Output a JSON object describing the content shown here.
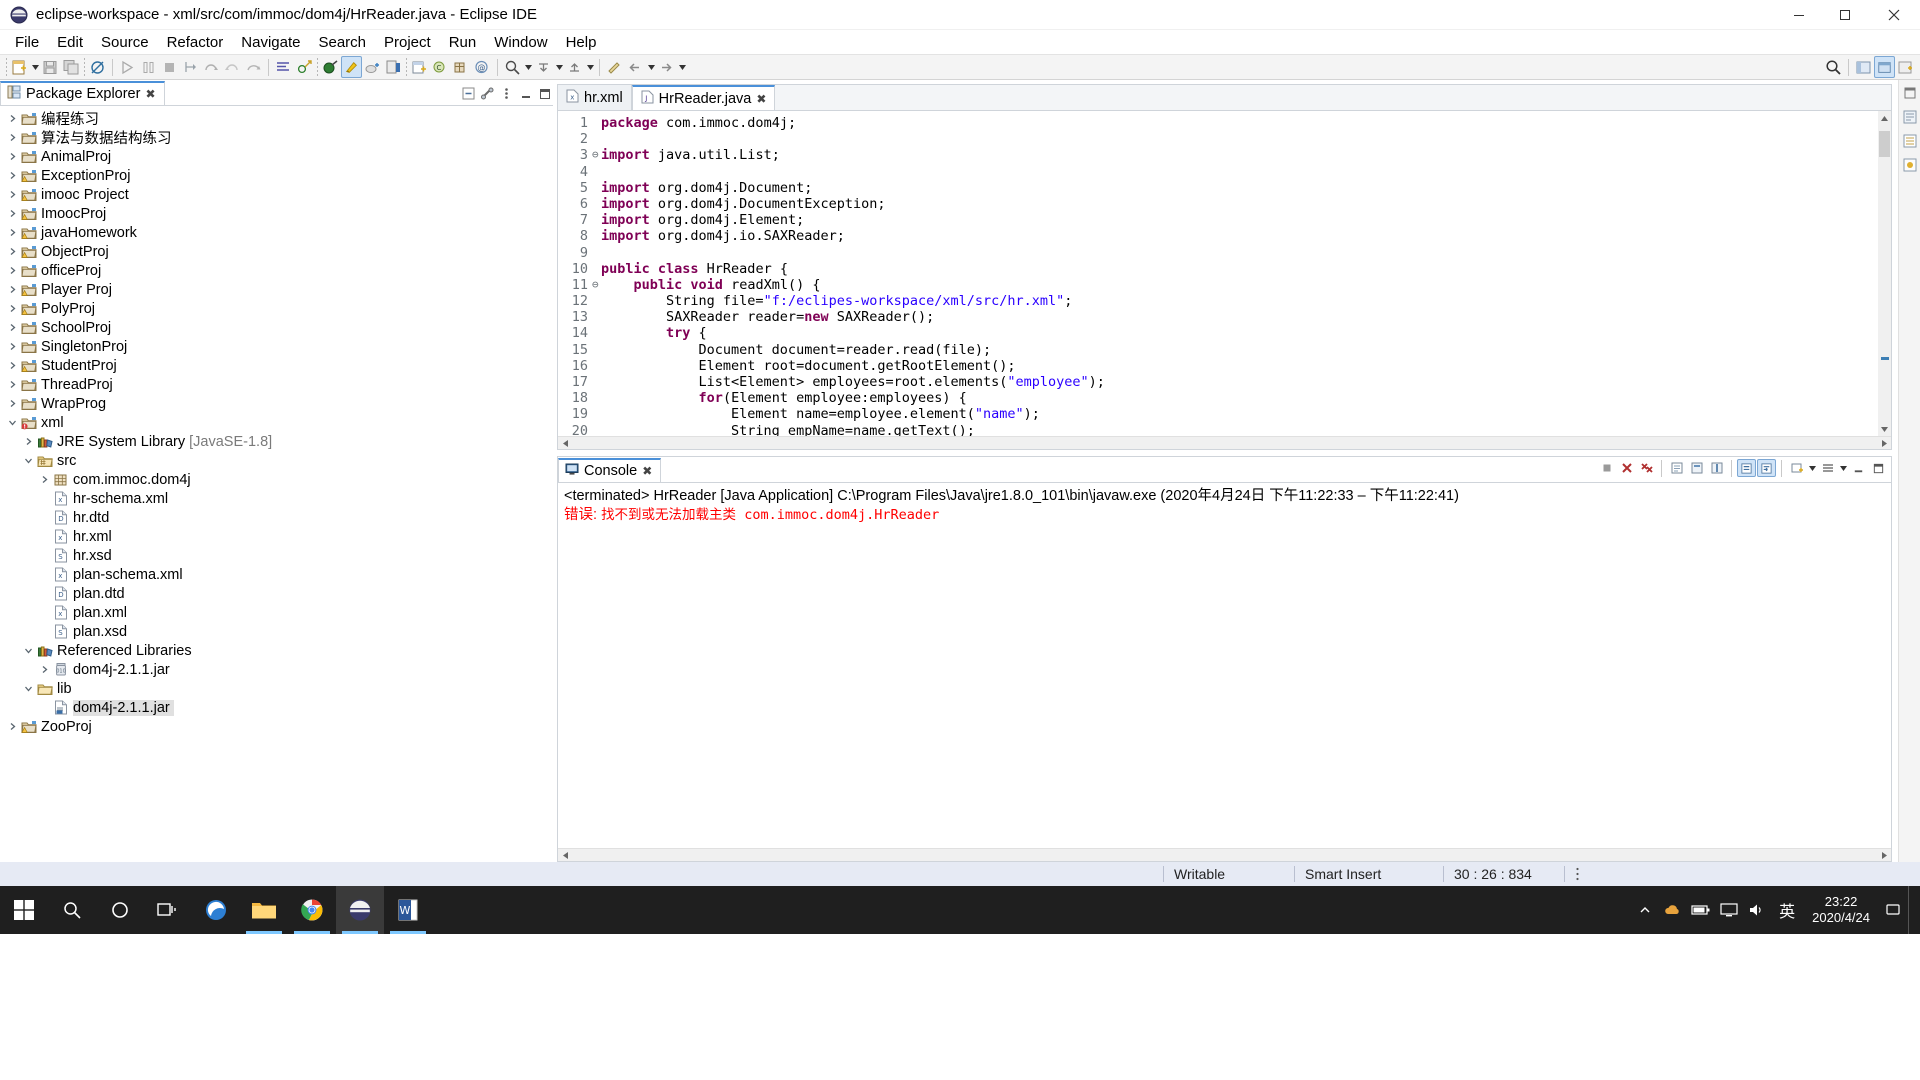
{
  "window": {
    "title": "eclipse-workspace - xml/src/com/immoc/dom4j/HrReader.java - Eclipse IDE",
    "app_icon": "eclipse-icon",
    "minimize_label": "—",
    "maximize_label": "❐",
    "close_label": "✕"
  },
  "menubar": {
    "items": [
      {
        "label": "File"
      },
      {
        "label": "Edit"
      },
      {
        "label": "Source"
      },
      {
        "label": "Refactor"
      },
      {
        "label": "Navigate"
      },
      {
        "label": "Search"
      },
      {
        "label": "Project"
      },
      {
        "label": "Run"
      },
      {
        "label": "Window"
      },
      {
        "label": "Help"
      }
    ]
  },
  "toolbar": {
    "groups": [
      [
        "new-wizard-icon",
        "dropdown-arrow",
        "save-icon",
        "save-all-icon"
      ],
      [
        "toggle-breadcrumb-icon"
      ],
      [
        "run-icon",
        "pause-icon",
        "stop-icon",
        "step-into-icon",
        "step-over-icon",
        "step-return-icon",
        "resume-icon"
      ],
      [
        "open-task-icon",
        "skip-breakpoints-icon"
      ],
      [
        "new-java-project-icon",
        "new-java-class-icon",
        "new-package-icon",
        "new-annotation-icon"
      ],
      [
        "open-type-icon",
        "quick-access-icon"
      ],
      [
        "toggle-mark-occurrences-icon",
        "show-whitespace-icon",
        "block-selection-icon"
      ],
      [
        "debug-icon",
        "run-as-icon",
        "coverage-icon",
        "external-tools-icon"
      ],
      [
        "search-icon",
        "next-annotation-icon",
        "previous-annotation-icon",
        "last-edit-icon",
        "back-icon",
        "forward-icon"
      ]
    ],
    "right": [
      "search-icon",
      "perspective-java-icon",
      "perspective-debug-icon",
      "open-perspective-icon"
    ]
  },
  "package_explorer": {
    "tab_label": "Package Explorer",
    "tab_icon": "package-explorer-icon",
    "close_icon": "close-icon",
    "view_buttons": [
      "collapse-all-icon",
      "link-with-editor-icon",
      "view-menu-icon",
      "minimize-icon",
      "maximize-icon"
    ],
    "tree": [
      {
        "label": "编程练习",
        "indent": 0,
        "state": "collapsed",
        "icon": "project-icon"
      },
      {
        "label": "算法与数据结构练习",
        "indent": 0,
        "state": "collapsed",
        "icon": "project-icon"
      },
      {
        "label": "AnimalProj",
        "indent": 0,
        "state": "collapsed",
        "icon": "project-icon"
      },
      {
        "label": "ExceptionProj",
        "indent": 0,
        "state": "collapsed",
        "icon": "project-warning-icon"
      },
      {
        "label": "imooc Project",
        "indent": 0,
        "state": "collapsed",
        "icon": "project-warning-icon"
      },
      {
        "label": "ImoocProj",
        "indent": 0,
        "state": "collapsed",
        "icon": "project-warning-icon"
      },
      {
        "label": "javaHomework",
        "indent": 0,
        "state": "collapsed",
        "icon": "project-warning-icon"
      },
      {
        "label": "ObjectProj",
        "indent": 0,
        "state": "collapsed",
        "icon": "project-warning-icon"
      },
      {
        "label": "officeProj",
        "indent": 0,
        "state": "collapsed",
        "icon": "project-icon"
      },
      {
        "label": "Player Proj",
        "indent": 0,
        "state": "collapsed",
        "icon": "project-warning-icon"
      },
      {
        "label": "PolyProj",
        "indent": 0,
        "state": "collapsed",
        "icon": "project-warning-icon"
      },
      {
        "label": "SchoolProj",
        "indent": 0,
        "state": "collapsed",
        "icon": "project-icon"
      },
      {
        "label": "SingletonProj",
        "indent": 0,
        "state": "collapsed",
        "icon": "project-icon"
      },
      {
        "label": "StudentProj",
        "indent": 0,
        "state": "collapsed",
        "icon": "project-warning-icon"
      },
      {
        "label": "ThreadProj",
        "indent": 0,
        "state": "collapsed",
        "icon": "project-icon"
      },
      {
        "label": "WrapProg",
        "indent": 0,
        "state": "collapsed",
        "icon": "project-icon"
      },
      {
        "label": "xml",
        "indent": 0,
        "state": "expanded",
        "icon": "project-error-icon"
      },
      {
        "label": "JRE System Library",
        "sublabel": " [JavaSE-1.8]",
        "indent": 1,
        "state": "collapsed",
        "icon": "library-icon"
      },
      {
        "label": "src",
        "indent": 1,
        "state": "expanded",
        "icon": "source-folder-icon"
      },
      {
        "label": "com.immoc.dom4j",
        "indent": 2,
        "state": "collapsed",
        "icon": "package-icon"
      },
      {
        "label": "hr-schema.xml",
        "indent": 2,
        "state": "leaf",
        "icon": "xml-file-icon"
      },
      {
        "label": "hr.dtd",
        "indent": 2,
        "state": "leaf",
        "icon": "dtd-file-icon"
      },
      {
        "label": "hr.xml",
        "indent": 2,
        "state": "leaf",
        "icon": "xml-file-icon"
      },
      {
        "label": "hr.xsd",
        "indent": 2,
        "state": "leaf",
        "icon": "xsd-file-icon"
      },
      {
        "label": "plan-schema.xml",
        "indent": 2,
        "state": "leaf",
        "icon": "xml-file-icon"
      },
      {
        "label": "plan.dtd",
        "indent": 2,
        "state": "leaf",
        "icon": "dtd-file-icon"
      },
      {
        "label": "plan.xml",
        "indent": 2,
        "state": "leaf",
        "icon": "xml-file-icon"
      },
      {
        "label": "plan.xsd",
        "indent": 2,
        "state": "leaf",
        "icon": "xsd-file-icon"
      },
      {
        "label": "Referenced Libraries",
        "indent": 1,
        "state": "expanded",
        "icon": "library-icon"
      },
      {
        "label": "dom4j-2.1.1.jar",
        "indent": 2,
        "state": "collapsed",
        "icon": "jar-icon"
      },
      {
        "label": "lib",
        "indent": 1,
        "state": "expanded",
        "icon": "folder-icon"
      },
      {
        "label": "dom4j-2.1.1.jar",
        "indent": 2,
        "state": "leaf",
        "icon": "jar-file-icon",
        "selected": true
      },
      {
        "label": "ZooProj",
        "indent": 0,
        "state": "collapsed",
        "icon": "project-warning-icon"
      }
    ]
  },
  "editor": {
    "tabs": [
      {
        "label": "hr.xml",
        "icon": "xml-file-icon",
        "active": false
      },
      {
        "label": "HrReader.java",
        "icon": "java-file-icon",
        "active": true,
        "close_icon": "close-icon"
      }
    ],
    "code_lines": [
      {
        "n": "1",
        "fold": "",
        "tokens": [
          {
            "t": "package ",
            "c": "kw"
          },
          {
            "t": "com.immoc.dom4j;",
            "c": "plain"
          }
        ]
      },
      {
        "n": "2",
        "fold": "",
        "tokens": []
      },
      {
        "n": "3",
        "fold": "⊖",
        "tokens": [
          {
            "t": "import ",
            "c": "kw"
          },
          {
            "t": "java.util.List;",
            "c": "plain"
          }
        ]
      },
      {
        "n": "4",
        "fold": "",
        "tokens": []
      },
      {
        "n": "5",
        "fold": "",
        "tokens": [
          {
            "t": "import ",
            "c": "kw"
          },
          {
            "t": "org.dom4j.Document;",
            "c": "plain"
          }
        ]
      },
      {
        "n": "6",
        "fold": "",
        "tokens": [
          {
            "t": "import ",
            "c": "kw"
          },
          {
            "t": "org.dom4j.DocumentException;",
            "c": "plain"
          }
        ]
      },
      {
        "n": "7",
        "fold": "",
        "tokens": [
          {
            "t": "import ",
            "c": "kw"
          },
          {
            "t": "org.dom4j.Element;",
            "c": "plain"
          }
        ]
      },
      {
        "n": "8",
        "fold": "",
        "tokens": [
          {
            "t": "import ",
            "c": "kw"
          },
          {
            "t": "org.dom4j.io.SAXReader;",
            "c": "plain"
          }
        ]
      },
      {
        "n": "9",
        "fold": "",
        "tokens": []
      },
      {
        "n": "10",
        "fold": "",
        "tokens": [
          {
            "t": "public class ",
            "c": "kw"
          },
          {
            "t": "HrReader {",
            "c": "plain"
          }
        ]
      },
      {
        "n": "11",
        "fold": "⊖",
        "tokens": [
          {
            "t": "    ",
            "c": "plain"
          },
          {
            "t": "public void ",
            "c": "kw"
          },
          {
            "t": "readXml() {",
            "c": "plain"
          }
        ]
      },
      {
        "n": "12",
        "fold": "",
        "tokens": [
          {
            "t": "        String file=",
            "c": "plain"
          },
          {
            "t": "\"f:/eclipes-workspace/xml/src/hr.xml\"",
            "c": "str"
          },
          {
            "t": ";",
            "c": "plain"
          }
        ]
      },
      {
        "n": "13",
        "fold": "",
        "tokens": [
          {
            "t": "        SAXReader reader=",
            "c": "plain"
          },
          {
            "t": "new ",
            "c": "kw"
          },
          {
            "t": "SAXReader();",
            "c": "plain"
          }
        ]
      },
      {
        "n": "14",
        "fold": "",
        "tokens": [
          {
            "t": "        ",
            "c": "plain"
          },
          {
            "t": "try ",
            "c": "kw"
          },
          {
            "t": "{",
            "c": "plain"
          }
        ]
      },
      {
        "n": "15",
        "fold": "",
        "tokens": [
          {
            "t": "            Document document=reader.read(file);",
            "c": "plain"
          }
        ]
      },
      {
        "n": "16",
        "fold": "",
        "tokens": [
          {
            "t": "            Element root=document.getRootElement();",
            "c": "plain"
          }
        ]
      },
      {
        "n": "17",
        "fold": "",
        "tokens": [
          {
            "t": "            List<Element> employees=root.elements(",
            "c": "plain"
          },
          {
            "t": "\"employee\"",
            "c": "str"
          },
          {
            "t": ");",
            "c": "plain"
          }
        ]
      },
      {
        "n": "18",
        "fold": "",
        "tokens": [
          {
            "t": "            ",
            "c": "plain"
          },
          {
            "t": "for",
            "c": "kw"
          },
          {
            "t": "(Element employee:employees) {",
            "c": "plain"
          }
        ]
      },
      {
        "n": "19",
        "fold": "",
        "tokens": [
          {
            "t": "                Element name=employee.element(",
            "c": "plain"
          },
          {
            "t": "\"name\"",
            "c": "str"
          },
          {
            "t": ");",
            "c": "plain"
          }
        ]
      },
      {
        "n": "20",
        "fold": "",
        "tokens": [
          {
            "t": "                String empName=name.getText();",
            "c": "plain"
          }
        ]
      }
    ]
  },
  "console": {
    "tab_label": "Console",
    "tab_icon": "console-icon",
    "close_icon": "close-icon",
    "toolbar_buttons": [
      "terminate-icon",
      "remove-launch-icon",
      "remove-all-terminated-icon",
      "open-console-icon",
      "display-selected-console-icon",
      "pin-console-icon",
      "scroll-lock-icon",
      "word-wrap-icon",
      "new-console-view-icon",
      "view-menu-icon",
      "minimize-icon",
      "maximize-icon"
    ],
    "header_line": "<terminated> HrReader [Java Application] C:\\Program Files\\Java\\jre1.8.0_101\\bin\\javaw.exe  (2020年4月24日 下午11:22:33 – 下午11:22:41)",
    "error_prefix": "错误: ",
    "error_text": "找不到或无法加载主类 com.immoc.dom4j.HrReader",
    "error_color": "#ff0000"
  },
  "statusbar": {
    "writable": "Writable",
    "insert_mode": "Smart Insert",
    "position": "30 : 26 : 834"
  },
  "taskbar": {
    "start_icon": "windows-start-icon",
    "items": [
      {
        "icon": "search-icon",
        "name": "taskbar-search"
      },
      {
        "icon": "cortana-icon",
        "name": "taskbar-cortana"
      },
      {
        "icon": "task-view-icon",
        "name": "taskbar-task-view"
      },
      {
        "icon": "edge-icon",
        "name": "taskbar-edge"
      },
      {
        "icon": "file-explorer-icon",
        "name": "taskbar-file-explorer"
      },
      {
        "icon": "chrome-icon",
        "name": "taskbar-chrome"
      },
      {
        "icon": "eclipse-icon",
        "name": "taskbar-eclipse"
      },
      {
        "icon": "word-icon",
        "name": "taskbar-word"
      }
    ],
    "tray": [
      "chevron-up-icon",
      "onedrive-icon",
      "battery-icon",
      "monitor-icon",
      "volume-icon"
    ],
    "ime_label": "英",
    "clock_time": "23:22",
    "clock_date": "2020/4/24"
  },
  "colors": {
    "accent": "#4a90d9",
    "selection": "#cfe3f7",
    "keyword": "#7f0055",
    "string": "#2a00ff",
    "error": "#ff0000",
    "statusbar_bg": "#e6eaf4",
    "taskbar_bg": "#1f1f1f"
  }
}
